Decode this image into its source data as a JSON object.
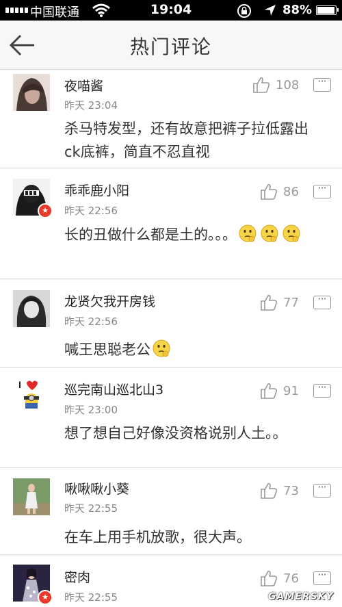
{
  "status": {
    "carrier": "中国联通",
    "time": "19:04",
    "battery": "88%",
    "battery_level": 0.88
  },
  "nav": {
    "title": "热门评论"
  },
  "comments": [
    {
      "name": "夜喵酱",
      "time": "昨天 23:04",
      "likes": "108",
      "text": "杀马特发型，还有故意把裤子拉低露出ck底裤，简直不忍直视",
      "emojis": 0,
      "verified": false
    },
    {
      "name": "乖乖鹿小阳",
      "time": "昨天 22:56",
      "likes": "86",
      "text": "长的丑做什么都是土的。。。",
      "emojis": 3,
      "verified": true
    },
    {
      "name": "龙贤欠我开房钱",
      "time": "昨天 22:56",
      "likes": "77",
      "text": "喊王思聪老公",
      "emojis": 1,
      "verified": false
    },
    {
      "name": "巡完南山巡北山3",
      "time": "昨天 23:00",
      "likes": "91",
      "text": "想了想自己好像没资格说别人土。。",
      "emojis": 0,
      "verified": false
    },
    {
      "name": "啾啾啾小葵",
      "time": "昨天 22:55",
      "likes": "73",
      "text": "在车上用手机放歌，很大声。",
      "emojis": 0,
      "verified": false
    },
    {
      "name": "密肉",
      "time": "昨天 22:55",
      "likes": "76",
      "text": "",
      "emojis": 0,
      "verified": true
    }
  ],
  "watermark": "GAMERSKY"
}
